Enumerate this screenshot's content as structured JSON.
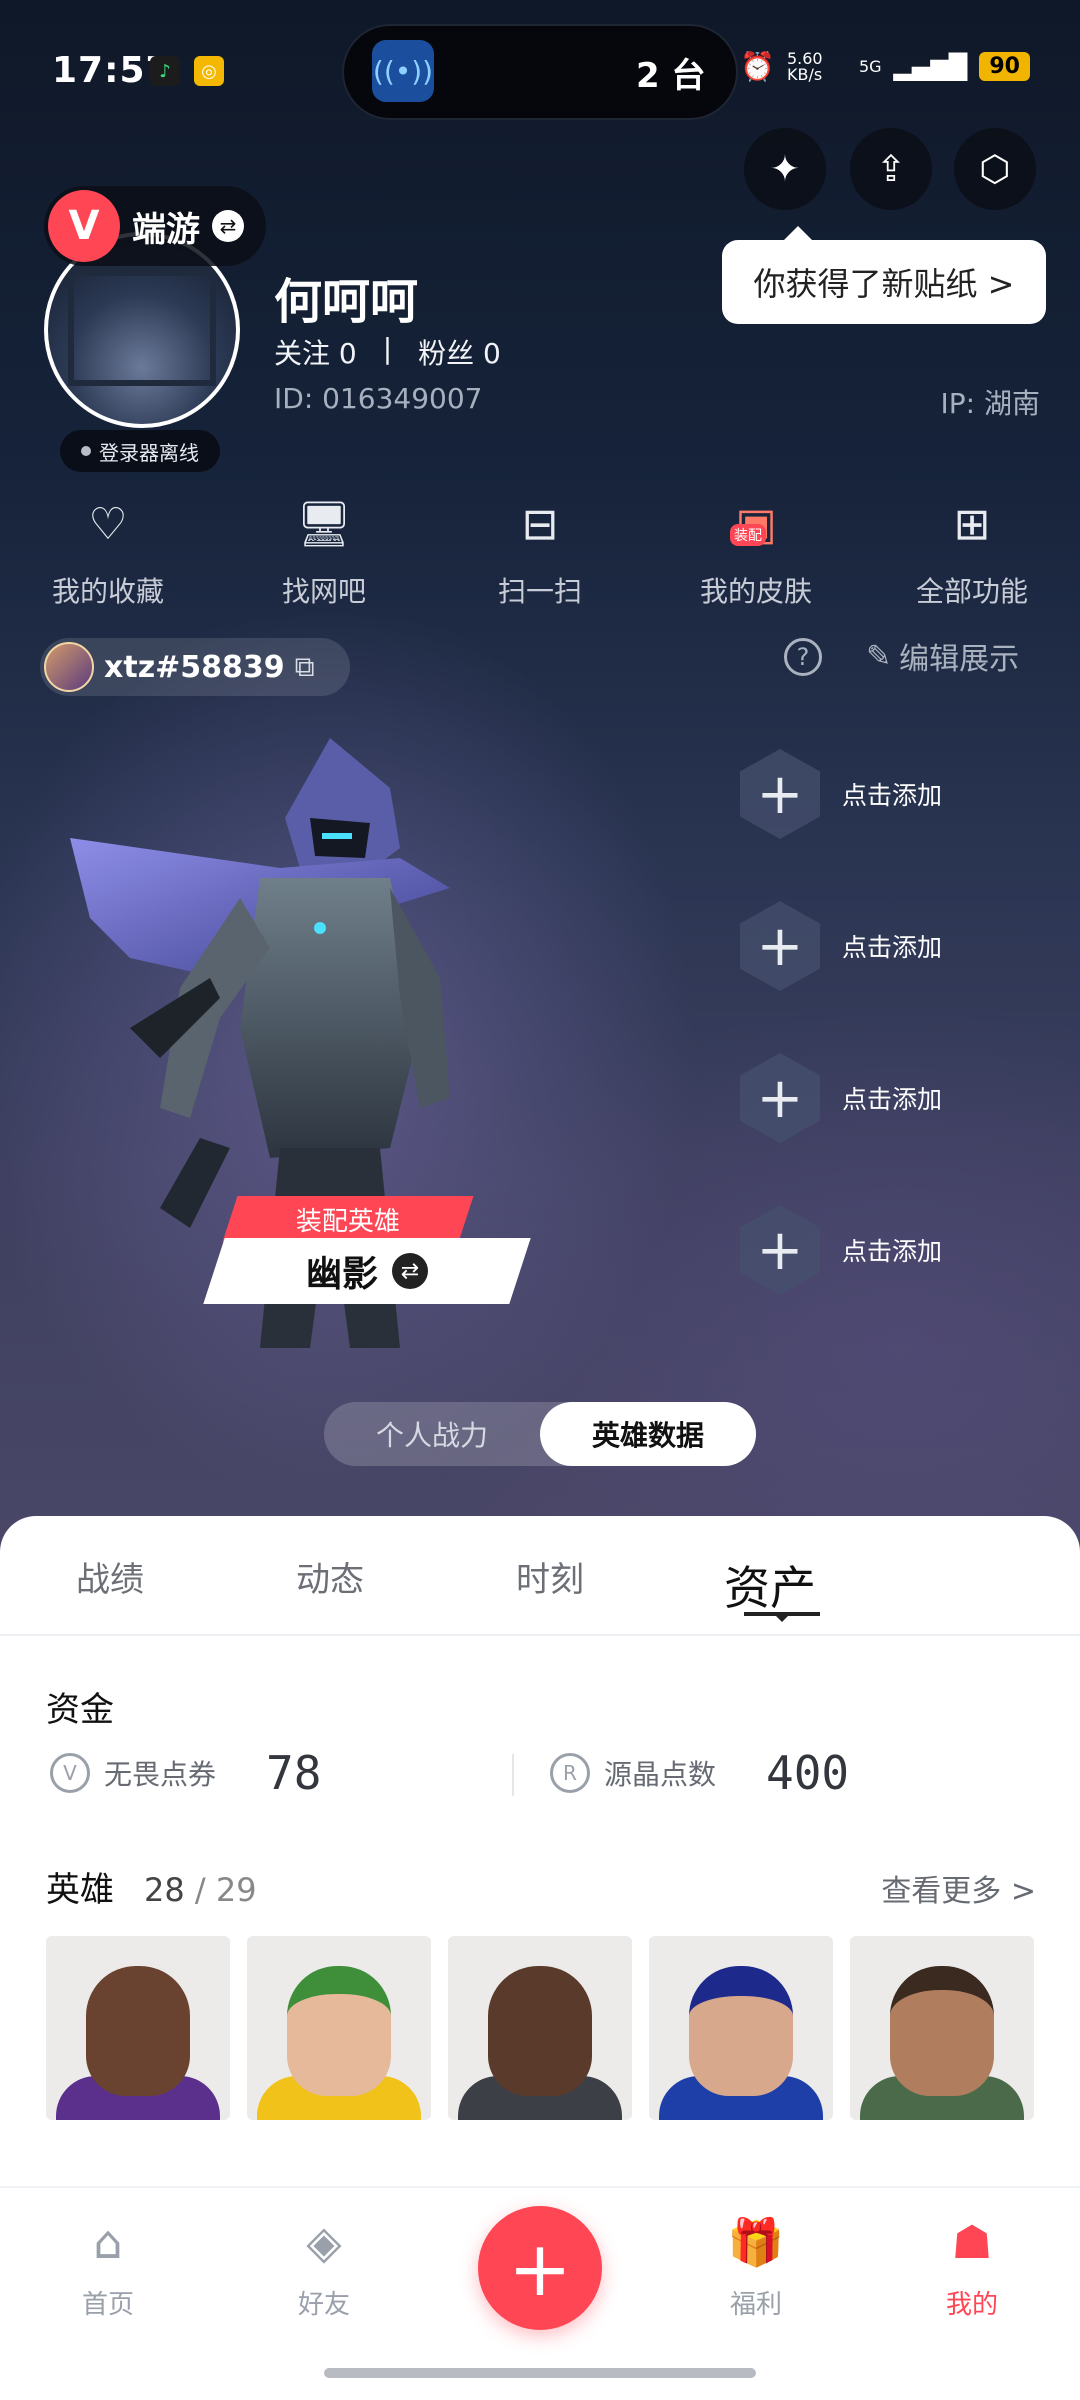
{
  "status": {
    "time": "17:57",
    "island_count": "2 台",
    "island_badge": "2",
    "net_speed": "5.60 KB/s",
    "net_type": "5G",
    "battery": "90"
  },
  "header": {
    "game_name": "端游",
    "game_logo_letter": "V",
    "tooltip": "你获得了新贴纸 >",
    "username": "何呵呵",
    "follow": "关注 0",
    "sep": "|",
    "fans": "粉丝 0",
    "uid": "ID: 016349007",
    "ip": "IP: 湖南",
    "launcher_status": "登录器离线"
  },
  "actions": [
    {
      "label": "我的收藏",
      "icon": "heart-icon",
      "glyph": "♡"
    },
    {
      "label": "找网吧",
      "icon": "monitor-icon",
      "glyph": "🖥"
    },
    {
      "label": "扫一扫",
      "icon": "scan-icon",
      "glyph": "⊟"
    },
    {
      "label": "我的皮肤",
      "icon": "skin-icon",
      "glyph": "▣",
      "tag": "装配"
    },
    {
      "label": "全部功能",
      "icon": "grid-icon",
      "glyph": "⊞"
    }
  ],
  "account": {
    "name": "xtz#58839",
    "edit_label": "编辑展示"
  },
  "showcase": {
    "slot_label": "点击添加",
    "equip_label": "装配英雄",
    "hero_name": "幽影"
  },
  "toggle": {
    "left": "个人战力",
    "right": "英雄数据"
  },
  "tabs": [
    "战绩",
    "动态",
    "时刻",
    "资产"
  ],
  "funds": {
    "title": "资金",
    "items": [
      {
        "label": "无畏点券",
        "value": "78",
        "icon": "valorant-points-icon"
      },
      {
        "label": "源晶点数",
        "value": "400",
        "icon": "radianite-icon"
      }
    ]
  },
  "heroes": {
    "title": "英雄",
    "owned": "28",
    "total": "/ 29",
    "more": "查看更多 >"
  },
  "nav": [
    {
      "label": "首页",
      "icon": "home-icon",
      "glyph": "⌂"
    },
    {
      "label": "好友",
      "icon": "friends-icon",
      "glyph": "◈"
    },
    {
      "label": "福利",
      "icon": "gift-icon",
      "glyph": "🎁"
    },
    {
      "label": "我的",
      "icon": "profile-icon",
      "glyph": "☗"
    }
  ],
  "colors": {
    "accent": "#ff4655",
    "battery": "#f1b400"
  }
}
